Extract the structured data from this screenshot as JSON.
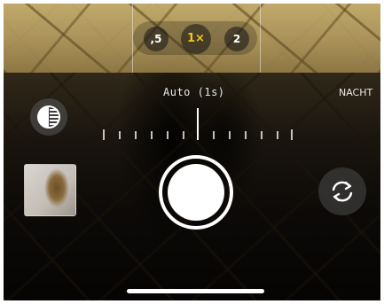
{
  "zoom": {
    "options": [
      ",5",
      "1×",
      "2"
    ],
    "active_index": 1
  },
  "exposure": {
    "label": "Auto (1s)",
    "level": 0.5
  },
  "modes": {
    "night_label": "NACHT"
  },
  "icons": {
    "filter": "styles-filter-icon",
    "flip": "camera-flip-icon"
  },
  "colors": {
    "accent": "#f5c518",
    "foreground": "#ffffff"
  }
}
